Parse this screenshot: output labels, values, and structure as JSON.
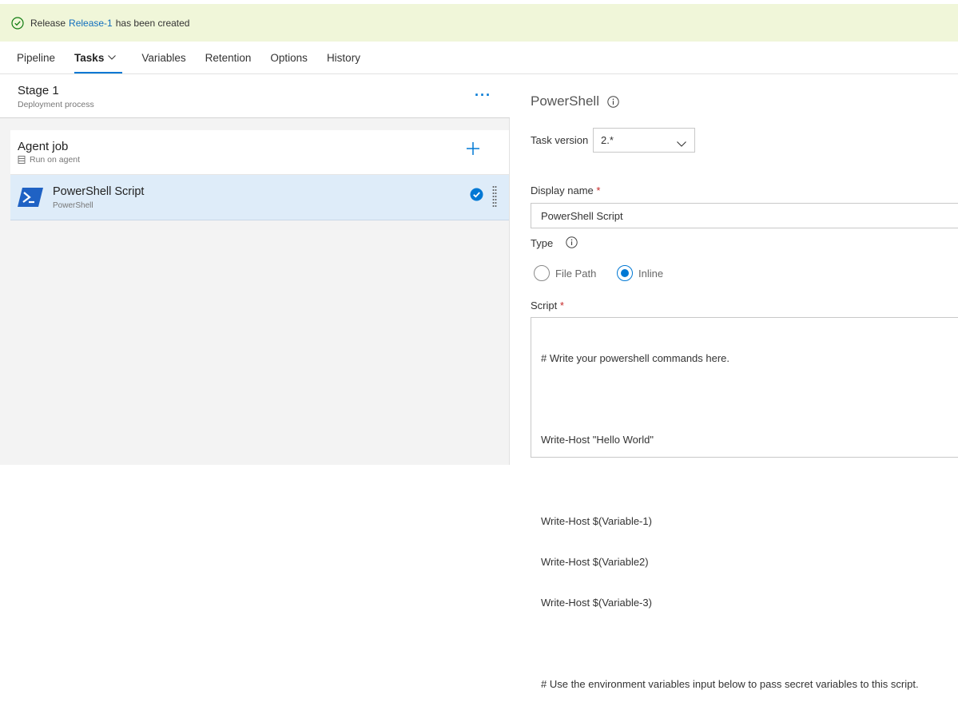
{
  "banner": {
    "prefix": "Release",
    "link": "Release-1",
    "suffix": "has been created",
    "icon": "check-circle-icon"
  },
  "tabs": [
    {
      "label": "Pipeline"
    },
    {
      "label": "Tasks"
    },
    {
      "label": "Variables"
    },
    {
      "label": "Retention"
    },
    {
      "label": "Options"
    },
    {
      "label": "History"
    }
  ],
  "stage": {
    "title": "Stage 1",
    "subtitle": "Deployment process",
    "more": "···"
  },
  "agent_job": {
    "title": "Agent job",
    "subtitle": "Run on agent"
  },
  "task": {
    "title": "PowerShell Script",
    "subtitle": "PowerShell"
  },
  "panel": {
    "title": "PowerShell",
    "task_version_label": "Task version",
    "task_version_value": "2.*",
    "display_name_label": "Display name",
    "display_name_value": "PowerShell Script",
    "required_marker": "*",
    "type_label": "Type",
    "type_options": [
      "File Path",
      "Inline"
    ],
    "type_selected": "Inline",
    "script_label": "Script",
    "script_lines": [
      "# Write your powershell commands here.",
      "",
      "Write-Host \"Hello World\"",
      "",
      "Write-Host $(Variable-1)",
      "Write-Host $(Variable2)",
      "Write-Host $(Variable-3)",
      "",
      "# Use the environment variables input below to pass secret variables to this script."
    ]
  },
  "colors": {
    "accent": "#0078d4",
    "banner_bg": "#f0f6d9",
    "selected_row": "#deecf9",
    "success": "#107c10"
  }
}
